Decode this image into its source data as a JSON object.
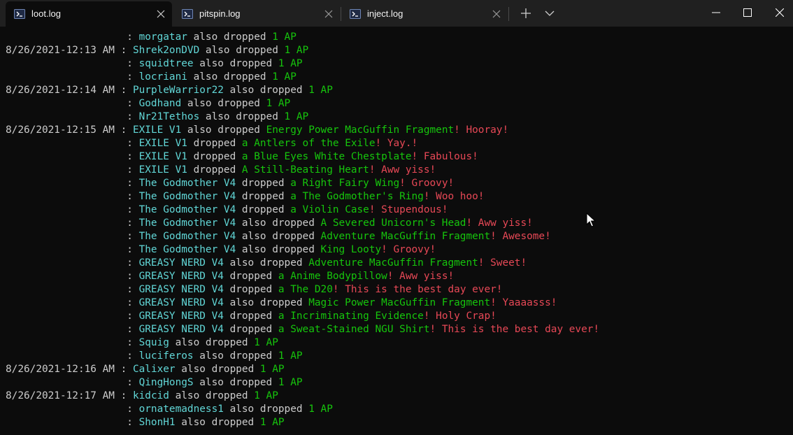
{
  "tabs": [
    {
      "label": "loot.log",
      "active": true
    },
    {
      "label": "pitspin.log",
      "active": false
    },
    {
      "label": "inject.log",
      "active": false
    }
  ],
  "colors": {
    "background": "#0c0c0c",
    "titlebar": "#202020",
    "text": "#cccccc",
    "name": "#61d6d6",
    "item": "#16c60c",
    "exclamation": "#e74856"
  },
  "terminal": {
    "lines": [
      {
        "ts": "                    : ",
        "name": "morgatar",
        "verb": " also dropped ",
        "item": "1 AP",
        "excl": ""
      },
      {
        "ts": "8/26/2021-12:13 AM : ",
        "name": "Shrek2onDVD",
        "verb": " also dropped ",
        "item": "1 AP",
        "excl": ""
      },
      {
        "ts": "                    : ",
        "name": "squidtree",
        "verb": " also dropped ",
        "item": "1 AP",
        "excl": ""
      },
      {
        "ts": "                    : ",
        "name": "locriani",
        "verb": " also dropped ",
        "item": "1 AP",
        "excl": ""
      },
      {
        "ts": "8/26/2021-12:14 AM : ",
        "name": "PurpleWarrior22",
        "verb": " also dropped ",
        "item": "1 AP",
        "excl": ""
      },
      {
        "ts": "                    : ",
        "name": "Godhand",
        "verb": " also dropped ",
        "item": "1 AP",
        "excl": ""
      },
      {
        "ts": "                    : ",
        "name": "Nr21Tethos",
        "verb": " also dropped ",
        "item": "1 AP",
        "excl": ""
      },
      {
        "ts": "8/26/2021-12:15 AM : ",
        "name": "EXILE V1",
        "verb": " also dropped ",
        "item": "Energy Power MacGuffin Fragment",
        "excl": "! Hooray!"
      },
      {
        "ts": "                    : ",
        "name": "EXILE V1",
        "verb": " dropped ",
        "item": "a Antlers of the Exile",
        "excl": "! Yay.!"
      },
      {
        "ts": "                    : ",
        "name": "EXILE V1",
        "verb": " dropped ",
        "item": "a Blue Eyes White Chestplate",
        "excl": "! Fabulous!"
      },
      {
        "ts": "                    : ",
        "name": "EXILE V1",
        "verb": " dropped ",
        "item": "A Still-Beating Heart",
        "excl": "! Aww yiss!"
      },
      {
        "ts": "                    : ",
        "name": "The Godmother V4",
        "verb": " dropped ",
        "item": "a Right Fairy Wing",
        "excl": "! Groovy!"
      },
      {
        "ts": "                    : ",
        "name": "The Godmother V4",
        "verb": " dropped ",
        "item": "a The Godmother's Ring",
        "excl": "! Woo hoo!"
      },
      {
        "ts": "                    : ",
        "name": "The Godmother V4",
        "verb": " dropped ",
        "item": "a Violin Case",
        "excl": "! Stupendous!"
      },
      {
        "ts": "                    : ",
        "name": "The Godmother V4",
        "verb": " also dropped ",
        "item": "A Severed Unicorn's Head",
        "excl": "! Aww yiss!"
      },
      {
        "ts": "                    : ",
        "name": "The Godmother V4",
        "verb": " also dropped ",
        "item": "Adventure MacGuffin Fragment",
        "excl": "! Awesome!"
      },
      {
        "ts": "                    : ",
        "name": "The Godmother V4",
        "verb": " also dropped ",
        "item": "King Looty",
        "excl": "! Groovy!"
      },
      {
        "ts": "                    : ",
        "name": "GREASY NERD V4",
        "verb": " also dropped ",
        "item": "Adventure MacGuffin Fragment",
        "excl": "! Sweet!"
      },
      {
        "ts": "                    : ",
        "name": "GREASY NERD V4",
        "verb": " dropped ",
        "item": "a Anime Bodypillow",
        "excl": "! Aww yiss!"
      },
      {
        "ts": "                    : ",
        "name": "GREASY NERD V4",
        "verb": " dropped ",
        "item": "a The D20",
        "excl": "! This is the best day ever!"
      },
      {
        "ts": "                    : ",
        "name": "GREASY NERD V4",
        "verb": " also dropped ",
        "item": "Magic Power MacGuffin Fragment",
        "excl": "! Yaaaasss!"
      },
      {
        "ts": "                    : ",
        "name": "GREASY NERD V4",
        "verb": " dropped ",
        "item": "a Incriminating Evidence",
        "excl": "! Holy Crap!"
      },
      {
        "ts": "                    : ",
        "name": "GREASY NERD V4",
        "verb": " dropped ",
        "item": "a Sweat-Stained NGU Shirt",
        "excl": "! This is the best day ever!"
      },
      {
        "ts": "                    : ",
        "name": "Squig",
        "verb": " also dropped ",
        "item": "1 AP",
        "excl": ""
      },
      {
        "ts": "                    : ",
        "name": "luciferos",
        "verb": " also dropped ",
        "item": "1 AP",
        "excl": ""
      },
      {
        "ts": "8/26/2021-12:16 AM : ",
        "name": "Calixer",
        "verb": " also dropped ",
        "item": "1 AP",
        "excl": ""
      },
      {
        "ts": "                    : ",
        "name": "QingHongS",
        "verb": " also dropped ",
        "item": "1 AP",
        "excl": ""
      },
      {
        "ts": "8/26/2021-12:17 AM : ",
        "name": "kidcid",
        "verb": " also dropped ",
        "item": "1 AP",
        "excl": ""
      },
      {
        "ts": "                    : ",
        "name": "ornatemadness1",
        "verb": " also dropped ",
        "item": "1 AP",
        "excl": ""
      },
      {
        "ts": "                    : ",
        "name": "ShonH1",
        "verb": " also dropped ",
        "item": "1 AP",
        "excl": ""
      }
    ]
  }
}
